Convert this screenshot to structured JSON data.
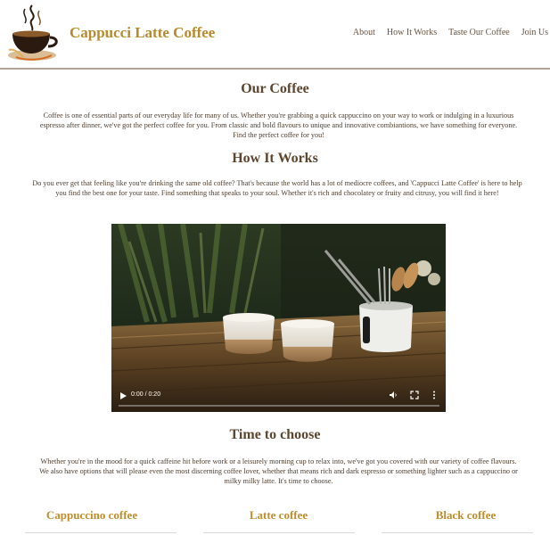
{
  "header": {
    "brand": "Cappucci Latte Coffee",
    "nav": [
      "About",
      "How It Works",
      "Taste Our Coffee",
      "Join Us"
    ]
  },
  "our_coffee": {
    "title": "Our Coffee",
    "text": "Coffee is one of essential parts of our everyday life for many of us. Whether you're grabbing a quick cappuccino on your way to work or indulging in a luxurious espresso after dinner, we've got the perfect coffee for you. From classic and bold flavours to unique and innovative combiantions, we have something for everyone. Find the perfect coffee for you!"
  },
  "how_it_works": {
    "title": "How It Works",
    "text": "Do you ever get that feeling like you're drinking the same old coffee? That's because the world has a lot of mediocre coffees, and 'Cappucci Latte Coffee' is here to help you find the best one for your taste. Find something that speaks to your soul. Whether it's rich and chocolatey or fruity and citrusy, you will find it here!"
  },
  "video": {
    "time": "0:00 / 0:20",
    "progress": 0
  },
  "time_to_choose": {
    "title": "Time to choose",
    "text": "Whether you're in the mood for a quick caffeine hit before work or a leisurely morning cup to relax into, we've got you covered with our variety of coffee flavours. We also have options that will please even the most discerning coffee lover, whether that means rich and dark espresso or something lighter such as a cappuccino or milky milky latte. It's time to choose."
  },
  "products": [
    "Cappuccino coffee",
    "Latte coffee",
    "Black coffee"
  ],
  "colors": {
    "brand": "#b88a2a",
    "heading": "#5c4630",
    "nav": "#6b5440"
  }
}
